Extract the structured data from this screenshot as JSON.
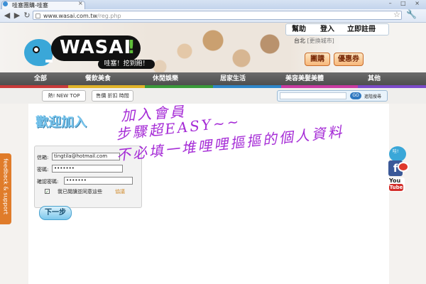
{
  "browser": {
    "tab_title": "哇塞團購-哇塞",
    "tab_close": "×",
    "window_controls": "– □ ×",
    "url_host": "www.wasai.com.tw",
    "url_path": "/reg.php",
    "back": "◀",
    "forward": "▶",
    "reload": "↻",
    "star": "☆",
    "wrench": "🔧"
  },
  "site": {
    "logo": "WASAI",
    "logo_excl": "!",
    "slogan": "哇塞！挖到飽！",
    "top_links": [
      "幫助",
      "登入",
      "立即註冊"
    ],
    "city": "台北",
    "city_change": "[更換城市]",
    "btn_group": "團購",
    "btn_coupon": "優惠券"
  },
  "nav": {
    "items": [
      "全部",
      "餐飲美食",
      "休閒娛樂",
      "居家生活",
      "美容美髮美體",
      "其他"
    ]
  },
  "subbar": {
    "tab1": "熱! NEW TOP",
    "tab2": "售價 折扣 時間",
    "search_placeholder": "",
    "go": "GO",
    "advanced": "進階搜尋"
  },
  "form": {
    "welcome": "歡迎加入",
    "email_label": "信箱:",
    "email_value": "tingtila@hotmail.com",
    "password_label": "密碼:",
    "password_value": "•••••••",
    "confirm_label": "確認密碼:",
    "confirm_value": "•••••••",
    "agree_check": "✓",
    "agree_text": "我已閱讀並同意這些",
    "terms_link": "協議",
    "next": "下一步"
  },
  "feedback": {
    "label": "feedback & support"
  },
  "annotation": {
    "line1": "加入會員",
    "line2": "步驟超EASY~~",
    "line3": "不必填一堆哩哩摳摳的個人資料"
  },
  "social": {
    "mascot_bubble": "哇!",
    "fb": "f",
    "yt_you": "You",
    "yt_tube": "Tube"
  }
}
